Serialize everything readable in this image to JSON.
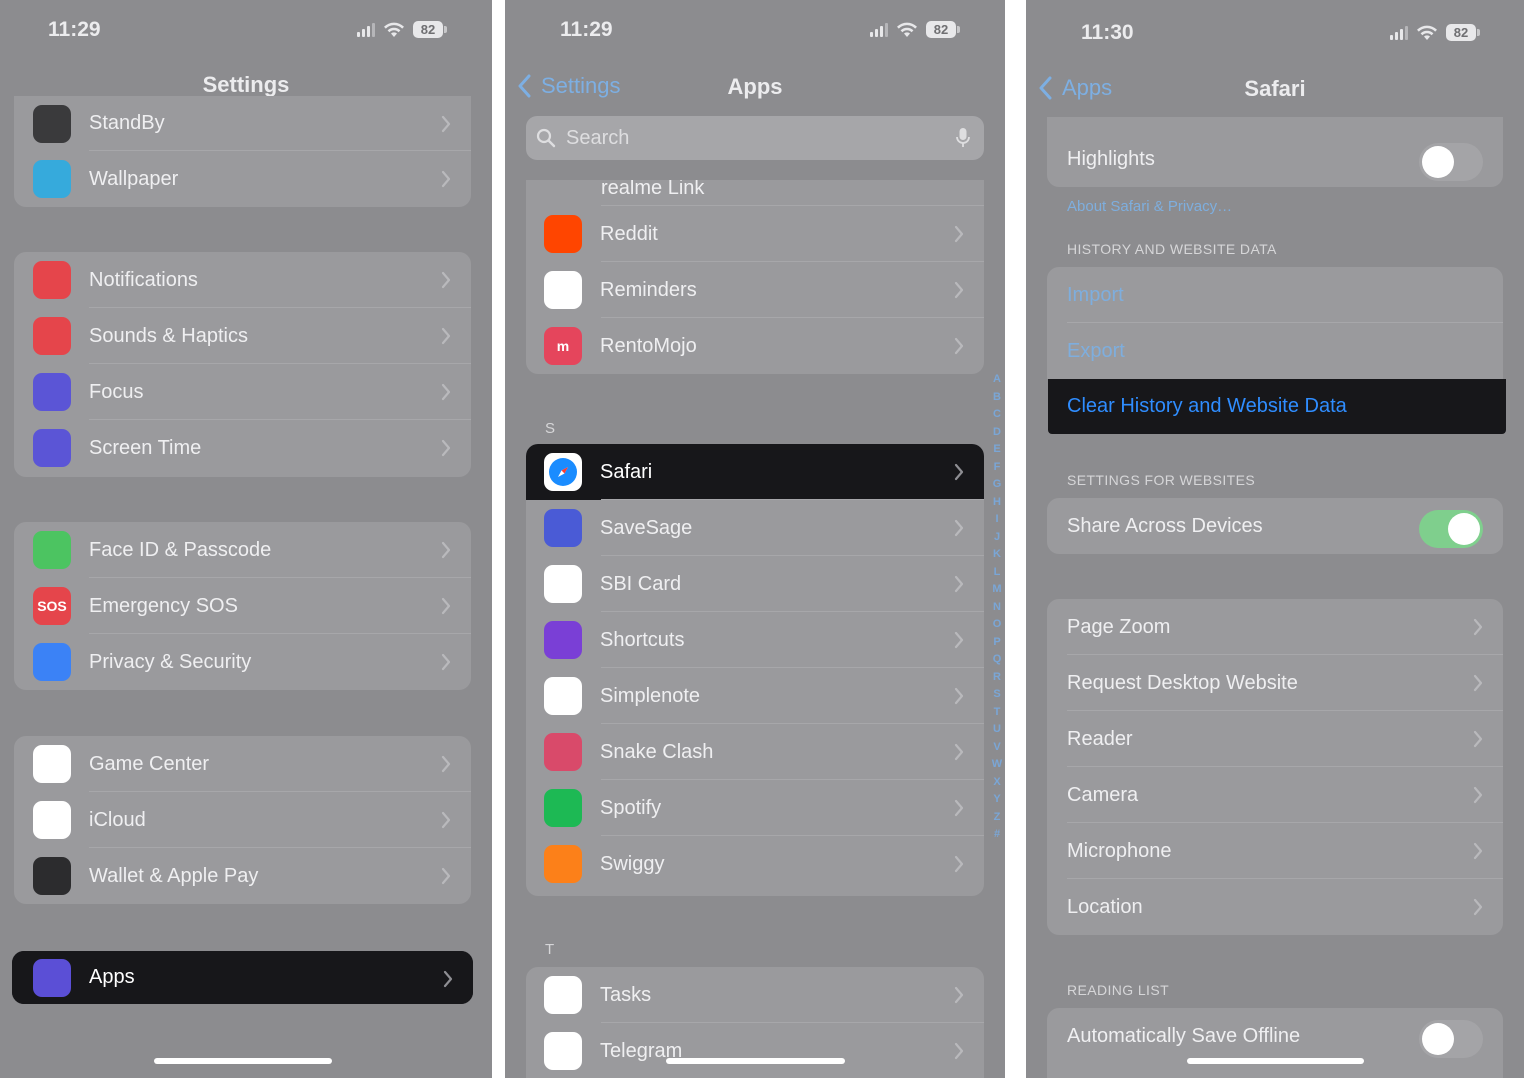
{
  "colors": {
    "accent_blue": "#2f8dff",
    "dim_blue": "#7eaede",
    "highlight_bg": "#17171a",
    "toggle_on": "#7fcf8d"
  },
  "screen1": {
    "time": "11:29",
    "battery": "82",
    "title": "Settings",
    "rows_top": [
      {
        "label": "StandBy",
        "icon": "standby-icon",
        "color": "#3a3a3c"
      },
      {
        "label": "Wallpaper",
        "icon": "wallpaper-flower-icon",
        "color": "#36aadc"
      }
    ],
    "rows_group1": [
      {
        "label": "Notifications",
        "icon": "bell-icon",
        "color": "#e5454b"
      },
      {
        "label": "Sounds & Haptics",
        "icon": "speaker-icon",
        "color": "#e5454b"
      },
      {
        "label": "Focus",
        "icon": "moon-icon",
        "color": "#5b55d6"
      },
      {
        "label": "Screen Time",
        "icon": "hourglass-icon",
        "color": "#5b55d6"
      }
    ],
    "rows_group2": [
      {
        "label": "Face ID & Passcode",
        "icon": "face-id-icon",
        "color": "#4cc461"
      },
      {
        "label": "Emergency SOS",
        "icon": "sos-icon",
        "icon_text": "SOS",
        "color": "#e5454b"
      },
      {
        "label": "Privacy & Security",
        "icon": "hand-icon",
        "color": "#3b82f6"
      }
    ],
    "rows_group3": [
      {
        "label": "Game Center",
        "icon": "game-center-icon",
        "color": "#ffffff"
      },
      {
        "label": "iCloud",
        "icon": "cloud-icon",
        "color": "#ffffff"
      },
      {
        "label": "Wallet & Apple Pay",
        "icon": "wallet-icon",
        "color": "#2c2c2e"
      }
    ],
    "apps_row": {
      "label": "Apps",
      "icon": "apps-grid-icon",
      "color": "#5b4fd6"
    }
  },
  "screen2": {
    "time": "11:29",
    "battery": "82",
    "back_label": "Settings",
    "title": "Apps",
    "search_placeholder": "Search",
    "partial_row": "realme Link",
    "rows_r": [
      {
        "label": "Reddit",
        "icon": "reddit-icon",
        "color": "#ff4500"
      },
      {
        "label": "Reminders",
        "icon": "reminders-icon",
        "color": "#ffffff"
      },
      {
        "label": "RentoMojo",
        "icon": "rentomojo-icon",
        "icon_text": "m",
        "color": "#e5455c"
      }
    ],
    "section_s": "S",
    "rows_s": [
      {
        "label": "Safari",
        "icon": "safari-compass-icon",
        "color": "#ffffff"
      },
      {
        "label": "SaveSage",
        "icon": "savesage-icon",
        "color": "#4a5bd6"
      },
      {
        "label": "SBI Card",
        "icon": "sbi-card-icon",
        "color": "#ffffff"
      },
      {
        "label": "Shortcuts",
        "icon": "shortcuts-icon",
        "color": "#7a3fd6"
      },
      {
        "label": "Simplenote",
        "icon": "simplenote-icon",
        "color": "#ffffff"
      },
      {
        "label": "Snake Clash",
        "icon": "snake-clash-icon",
        "color": "#d94a6a"
      },
      {
        "label": "Spotify",
        "icon": "spotify-icon",
        "color": "#1db954"
      },
      {
        "label": "Swiggy",
        "icon": "swiggy-icon",
        "color": "#fc8019"
      }
    ],
    "section_t": "T",
    "rows_t": [
      {
        "label": "Tasks",
        "icon": "tasks-icon",
        "color": "#ffffff"
      },
      {
        "label": "Telegram",
        "icon": "telegram-icon",
        "color": "#ffffff"
      }
    ],
    "index_letters": [
      "A",
      "B",
      "C",
      "D",
      "E",
      "F",
      "G",
      "H",
      "I",
      "J",
      "K",
      "L",
      "M",
      "N",
      "O",
      "P",
      "Q",
      "R",
      "S",
      "T",
      "U",
      "V",
      "W",
      "X",
      "Y",
      "Z",
      "#"
    ]
  },
  "screen3": {
    "time": "11:30",
    "battery": "82",
    "back_label": "Apps",
    "title": "Safari",
    "highlights_label": "Highlights",
    "highlights_on": false,
    "about_link": "About Safari & Privacy…",
    "section_history": "HISTORY AND WEBSITE DATA",
    "import_label": "Import",
    "export_label": "Export",
    "clear_label": "Clear History and Website Data",
    "section_websites": "SETTINGS FOR WEBSITES",
    "share_label": "Share Across Devices",
    "share_on": true,
    "website_rows": [
      "Page Zoom",
      "Request Desktop Website",
      "Reader",
      "Camera",
      "Microphone",
      "Location"
    ],
    "section_reading": "READING LIST",
    "auto_save_label": "Automatically Save Offline",
    "auto_save_on": false
  }
}
